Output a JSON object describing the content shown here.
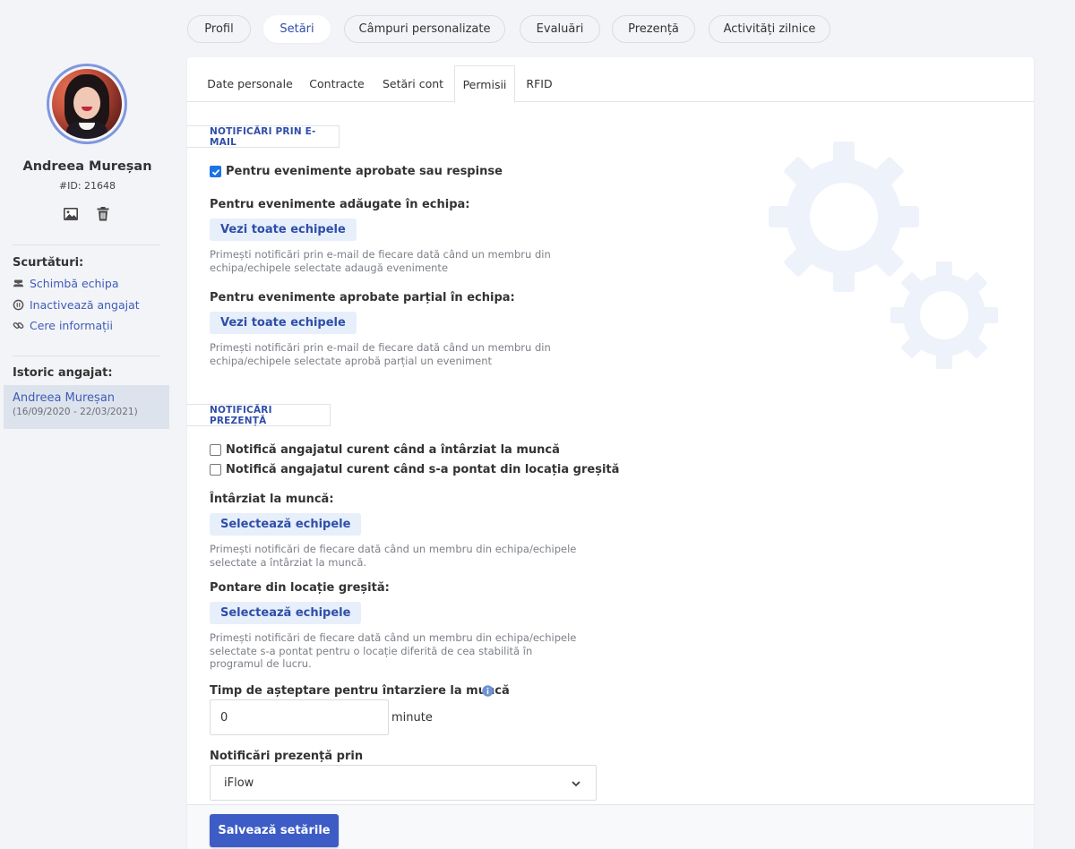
{
  "employee": {
    "name": "Andreea Mureșan",
    "id_label": "#ID: 21648"
  },
  "sidebar": {
    "shortcuts_heading": "Scurtături:",
    "shortcuts": [
      {
        "label": "Schimbă echipa",
        "icon": "users-icon"
      },
      {
        "label": "Inactivează angajat",
        "icon": "pause-circle-icon"
      },
      {
        "label": "Cere informații",
        "icon": "link-icon"
      }
    ],
    "history_heading": "Istoric angajat:",
    "history": [
      {
        "name": "Andreea Mureșan",
        "dates": "(16/09/2020 - 22/03/2021)"
      }
    ]
  },
  "top_tabs": [
    {
      "label": "Profil"
    },
    {
      "label": "Setări",
      "active": true
    },
    {
      "label": "Câmpuri personalizate"
    },
    {
      "label": "Evaluări"
    },
    {
      "label": "Prezență"
    },
    {
      "label": "Activități zilnice"
    }
  ],
  "sub_tabs": [
    {
      "label": "Date personale"
    },
    {
      "label": "Contracte"
    },
    {
      "label": "Setări cont"
    },
    {
      "label": "Permisii",
      "active": true
    },
    {
      "label": "RFID"
    }
  ],
  "email_section": {
    "title": "NOTIFICĂRI PRIN E-MAIL",
    "approved_checkbox": {
      "label": "Pentru evenimente aprobate sau respinse",
      "checked": true
    },
    "added_label": "Pentru evenimente adăugate în echipa:",
    "added_button": "Vezi toate echipele",
    "added_help": "Primești notificări prin e-mail de fiecare dată când un membru din echipa/echipele selectate adaugă evenimente",
    "partial_label": "Pentru evenimente aprobate parțial în echipa:",
    "partial_button": "Vezi toate echipele",
    "partial_help": "Primești notificări prin e-mail de fiecare dată când un membru din echipa/echipele selectate aprobă parțial un eveniment"
  },
  "presence_section": {
    "title": "NOTIFICĂRI PREZENȚĂ",
    "late_checkbox": {
      "label": "Notifică angajatul curent când a întârziat la muncă",
      "checked": false
    },
    "wrong_location_checkbox": {
      "label": "Notifică angajatul curent când s-a pontat din locația greșită",
      "checked": false
    },
    "late_label": "Întârziat la muncă:",
    "late_button": "Selectează echipele",
    "late_help": "Primești notificări de fiecare dată când un membru din echipa/echipele selectate a întârziat la muncă.",
    "wrong_label": "Pontare din locație greșită:",
    "wrong_button": "Selectează echipele",
    "wrong_help": "Primești notificări de fiecare dată când un membru din echipa/echipele selectate s-a pontat pentru o locație diferită de cea stabilită în programul de lucru.",
    "wait_label": "Timp de așteptare pentru întarziere la muncă",
    "wait_value": "0",
    "wait_unit": "minute",
    "channel_label": "Notificări prezență prin",
    "channel_value": "iFlow"
  },
  "save_button": "Salvează setările",
  "colors": {
    "accent": "#3d5cc6",
    "link": "#3d5cb8",
    "background": "#f3f4f7"
  }
}
